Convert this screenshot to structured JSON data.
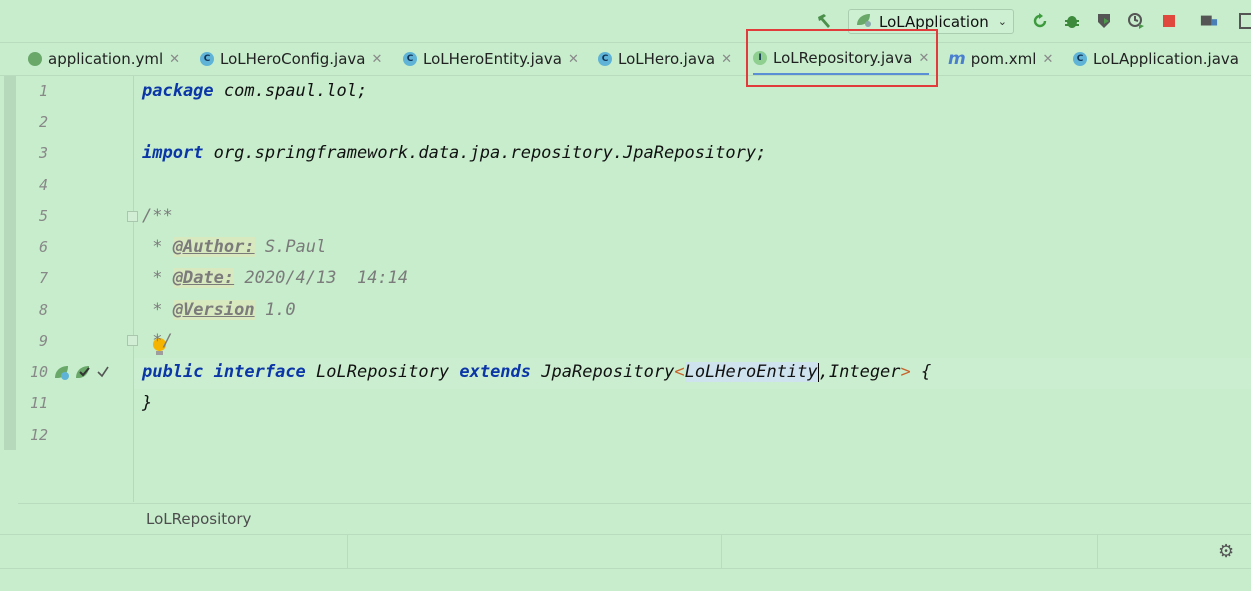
{
  "toolbar": {
    "run_config": "LoLApplication",
    "icons": [
      "hammer-build-icon",
      "rerun-icon",
      "debug-bug-icon",
      "coverage-icon",
      "profiler-icon",
      "stop-icon",
      "project-structure-icon",
      "layout-icon"
    ],
    "stop_color": "#e0483e"
  },
  "tabs": [
    {
      "label": "application.yml",
      "icon": "spring-yml-icon",
      "active": false
    },
    {
      "label": "LoLHeroConfig.java",
      "icon": "class-c-icon",
      "active": false
    },
    {
      "label": "LoLHeroEntity.java",
      "icon": "class-c-icon",
      "active": false
    },
    {
      "label": "LoLHero.java",
      "icon": "class-c-icon",
      "active": false
    },
    {
      "label": "LoLRepository.java",
      "icon": "interface-i-icon",
      "active": true
    },
    {
      "label": "pom.xml",
      "icon": "maven-m-icon",
      "active": false
    },
    {
      "label": "LoLApplication.java",
      "icon": "spring-class-icon",
      "active": false
    }
  ],
  "editor": {
    "line_numbers": [
      "1",
      "2",
      "3",
      "4",
      "5",
      "6",
      "7",
      "8",
      "9",
      "10",
      "11",
      "12"
    ],
    "lines": {
      "l1": {
        "kw": "package",
        "rest": " com.spaul.lol;"
      },
      "l3": {
        "kw": "import",
        "rest": " org.springframework.data.jpa.repository.JpaRepository;"
      },
      "l5": "/**",
      "l6": {
        "star": " * ",
        "tag": "@Author:",
        "val": " S.Paul"
      },
      "l7": {
        "star": " * ",
        "tag": "@Date:",
        "val": " 2020/4/13  14:14"
      },
      "l8": {
        "star": " * ",
        "tag": "@Version",
        "val": " 1.0"
      },
      "l9": " */",
      "l10": {
        "kw1": "public",
        "kw2": "interface",
        "name": "LoLRepository",
        "kw3": "extends",
        "super": "JpaRepository",
        "lt": "<",
        "arg1": "LoLHeroEntity",
        "arg2": ",Integer",
        "gt": ">",
        "brace": " {"
      },
      "l11": "}"
    }
  },
  "breadcrumb": "LoLRepository"
}
